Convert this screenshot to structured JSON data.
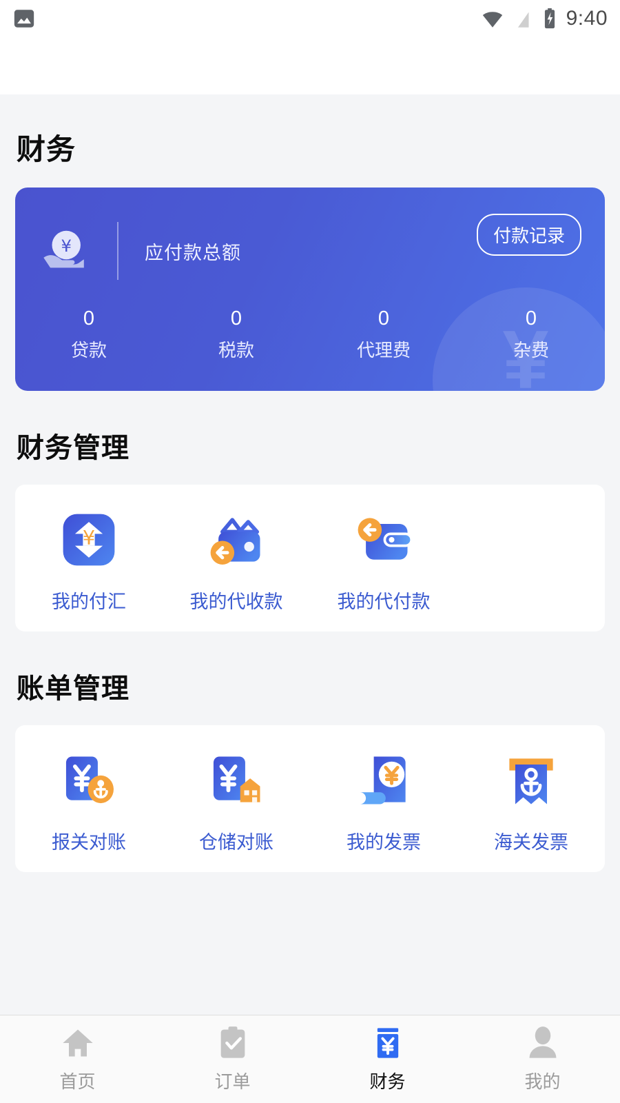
{
  "status_bar": {
    "time": "9:40",
    "icons": [
      "image-icon",
      "wifi-icon",
      "signal-off-icon",
      "battery-charging-icon"
    ]
  },
  "header": {
    "title": "财务"
  },
  "balance_card": {
    "icon": "hand-holding-yuan-coin-icon",
    "label": "应付款总额",
    "record_button": "付款记录",
    "watermark_symbol": "¥",
    "stats": [
      {
        "value": "0",
        "name": "贷款"
      },
      {
        "value": "0",
        "name": "税款"
      },
      {
        "value": "0",
        "name": "代理费"
      },
      {
        "value": "0",
        "name": "杂费"
      }
    ]
  },
  "sections": [
    {
      "title": "财务管理",
      "items": [
        {
          "label": "我的付汇",
          "icon": "exchange-payment-icon"
        },
        {
          "label": "我的代收款",
          "icon": "wallet-receive-icon"
        },
        {
          "label": "我的代付款",
          "icon": "wallet-pay-icon"
        }
      ]
    },
    {
      "title": "账单管理",
      "items": [
        {
          "label": "报关对账",
          "icon": "customs-statement-icon"
        },
        {
          "label": "仓储对账",
          "icon": "warehouse-statement-icon"
        },
        {
          "label": "我的发票",
          "icon": "invoice-icon"
        },
        {
          "label": "海关发票",
          "icon": "customs-invoice-icon"
        }
      ]
    }
  ],
  "tabbar": {
    "active": "财务",
    "tabs": [
      {
        "label": "首页",
        "icon": "home-icon"
      },
      {
        "label": "订单",
        "icon": "clipboard-check-icon"
      },
      {
        "label": "财务",
        "icon": "finance-yuan-icon"
      },
      {
        "label": "我的",
        "icon": "person-icon"
      }
    ]
  },
  "colors": {
    "accent_blue": "#3b5bd0",
    "card_gradient_from": "#4a53cf",
    "card_gradient_to": "#4e73e8",
    "orange": "#f5a33c",
    "page_bg": "#f4f5f7"
  }
}
